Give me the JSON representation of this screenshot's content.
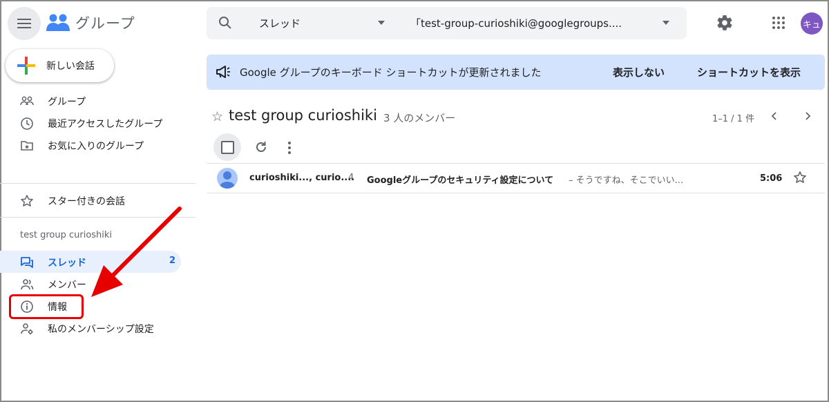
{
  "app": {
    "title": "グループ",
    "avatar_initials": "キュ"
  },
  "search": {
    "scope": "スレッド",
    "group": "「test-group-curioshiki@googlegroups...."
  },
  "sidebar": {
    "compose_label": "新しい会話",
    "items": [
      {
        "label": "グループ",
        "icon": "groups-icon"
      },
      {
        "label": "最近アクセスしたグループ",
        "icon": "clock-icon"
      },
      {
        "label": "お気に入りのグループ",
        "icon": "favorite-folder-icon"
      },
      {
        "label": "スター付きの会話",
        "icon": "star-icon"
      }
    ],
    "group_section": "test group curioshiki",
    "group_items": [
      {
        "label": "スレッド",
        "icon": "threads-icon",
        "count": "2",
        "active": true
      },
      {
        "label": "メンバー",
        "icon": "members-icon"
      },
      {
        "label": "情報",
        "icon": "info-icon"
      },
      {
        "label": "私のメンバーシップ設定",
        "icon": "member-settings-icon"
      }
    ]
  },
  "banner": {
    "text": "Google グループのキーボード ショートカットが更新されました",
    "dismiss_label": "表示しない",
    "show_label": "ショートカットを表示"
  },
  "group": {
    "title": "test group curioshiki",
    "members": "3 人のメンバー",
    "pagination": "1–1 / 1 件"
  },
  "threads": [
    {
      "sender": "curioshiki..., curio....",
      "count": "4",
      "subject": "Googleグループのセキュリティ設定について",
      "snippet": "– そうですね、そこでいい...",
      "time": "5:06"
    }
  ],
  "colors": {
    "accent": "#1967d2",
    "banner": "#d3e3fd",
    "annotation": "#e60000",
    "avatar": "#7e57c2"
  }
}
